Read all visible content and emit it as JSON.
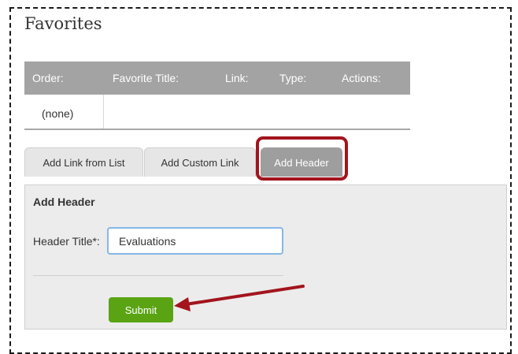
{
  "page": {
    "title": "Favorites"
  },
  "table": {
    "headers": [
      "Order:",
      "Favorite Title:",
      "Link:",
      "Type:",
      "Actions:"
    ],
    "empty_label": "(none)"
  },
  "tabs": [
    {
      "label": "Add Link from List",
      "active": false
    },
    {
      "label": "Add Custom Link",
      "active": false
    },
    {
      "label": "Add Header",
      "active": true
    }
  ],
  "form": {
    "title": "Add Header",
    "field_label": "Header Title*:",
    "field_value": "Evaluations",
    "submit_label": "Submit"
  },
  "annotation": {
    "highlight_color": "#a3141d",
    "arrow_color": "#a3141d"
  },
  "colors": {
    "submit_green": "#5aa414",
    "header_gray": "#a3a3a3",
    "input_focus": "#86b7e5"
  }
}
